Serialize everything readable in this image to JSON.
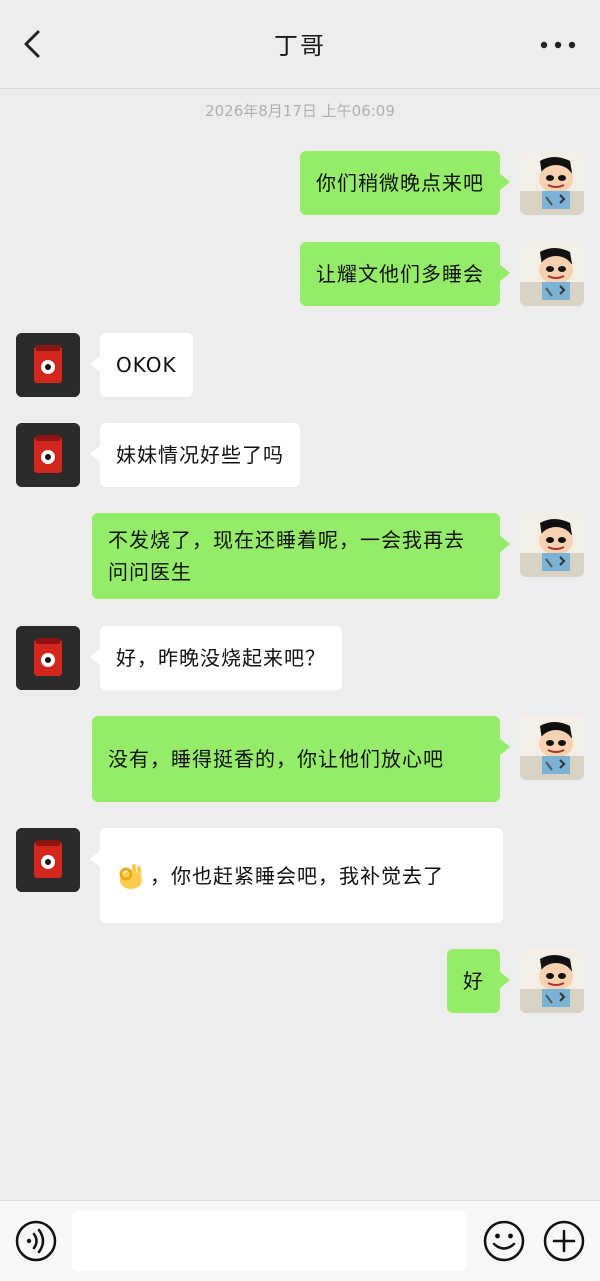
{
  "header": {
    "title": "丁哥",
    "back_icon": "chevron-left-icon",
    "more_icon": "ellipsis-icon"
  },
  "timestamp": "2026年8月17日 上午06:09",
  "messages": [
    {
      "sender": "me",
      "text": "你们稍微晚点来吧"
    },
    {
      "sender": "me",
      "text": "让耀文他们多睡会"
    },
    {
      "sender": "other",
      "text": "OKOK"
    },
    {
      "sender": "other",
      "text": "妹妹情况好些了吗"
    },
    {
      "sender": "me",
      "text": "不发烧了，现在还睡着呢，一会我再去问问医生"
    },
    {
      "sender": "other",
      "text": "好，昨晚没烧起来吧？"
    },
    {
      "sender": "me",
      "text": "没有，睡得挺香的，你让他们放心吧"
    },
    {
      "sender": "other",
      "emoji": "ok-hand-emoji",
      "text": "，你也赶紧睡会吧，我补觉去了"
    },
    {
      "sender": "me",
      "text": "好"
    }
  ],
  "footer": {
    "input_value": "",
    "voice_icon": "voice-icon",
    "emoji_icon": "smiley-icon",
    "plus_icon": "plus-circle-icon"
  },
  "colors": {
    "background": "#ededed",
    "my_bubble": "#95ec69",
    "other_bubble": "#ffffff"
  }
}
